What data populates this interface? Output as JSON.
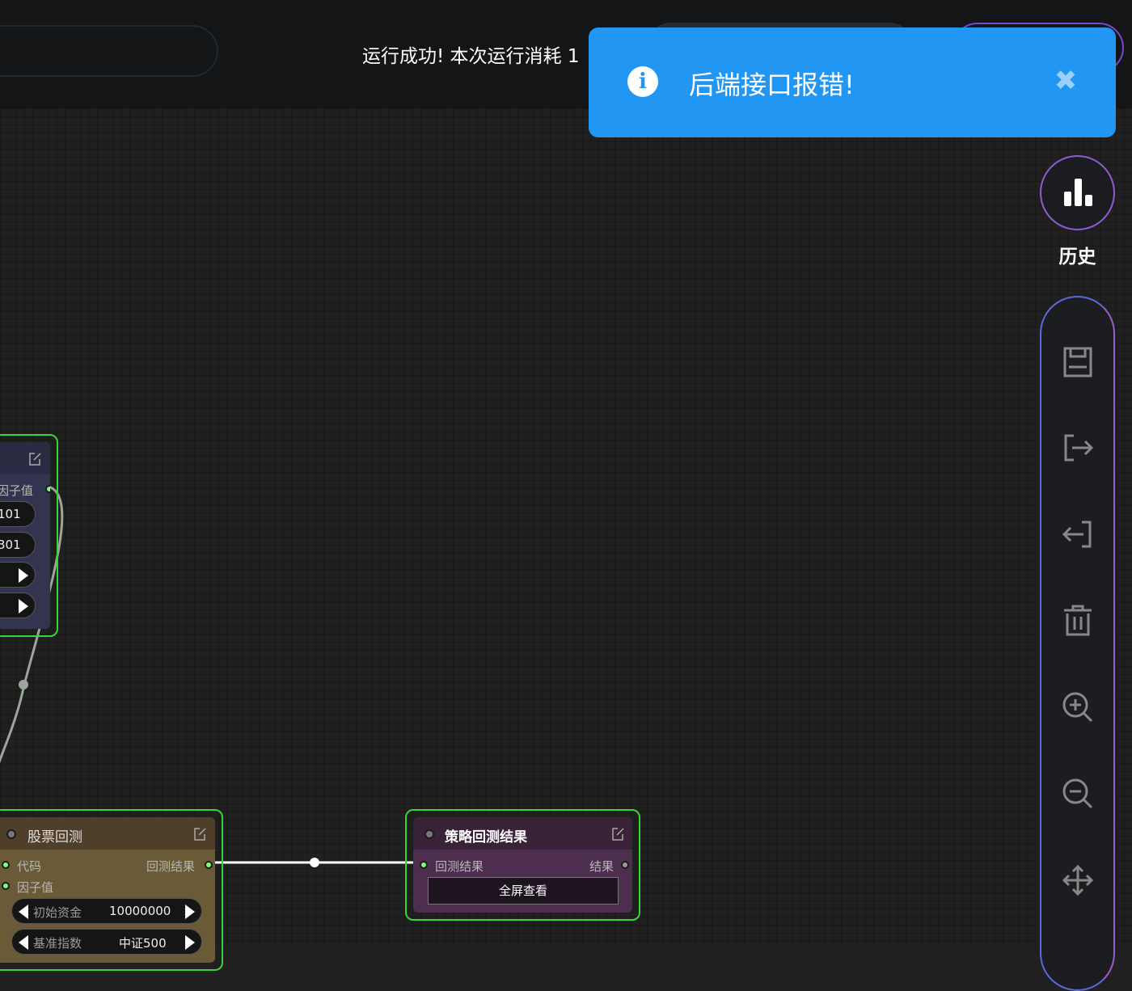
{
  "header": {
    "status_text": "运行成功!  本次运行消耗 1"
  },
  "toast": {
    "message": "后端接口报错!",
    "icon": "info-icon",
    "close_icon": "close-icon",
    "color": "#2196f3"
  },
  "history": {
    "label": "历史",
    "icon": "bar-chart-icon"
  },
  "toolbar": {
    "tools": [
      "save-icon",
      "export-icon",
      "import-icon",
      "trash-icon",
      "zoom-in-icon",
      "zoom-out-icon",
      "move-icon"
    ]
  },
  "nodes": {
    "factor_node": {
      "output_label": "因子值",
      "widget1_value": "101",
      "widget2_value": "301"
    },
    "backtest_node": {
      "title": "股票回测",
      "input1": "代码",
      "input2": "因子值",
      "output1": "回测结果",
      "widget1_label": "初始资金",
      "widget1_value": "10000000",
      "widget2_label": "基准指数",
      "widget2_value": "中证500"
    },
    "result_node": {
      "title": "策略回测结果",
      "input1": "回测结果",
      "output1": "结果",
      "button": "全屏查看"
    }
  },
  "colors": {
    "node_selected_border": "#3bd23b",
    "factor_node_bg": "#33344f",
    "backtest_node_bg": "#6b5a37",
    "result_node_bg": "#4d2e4f"
  }
}
